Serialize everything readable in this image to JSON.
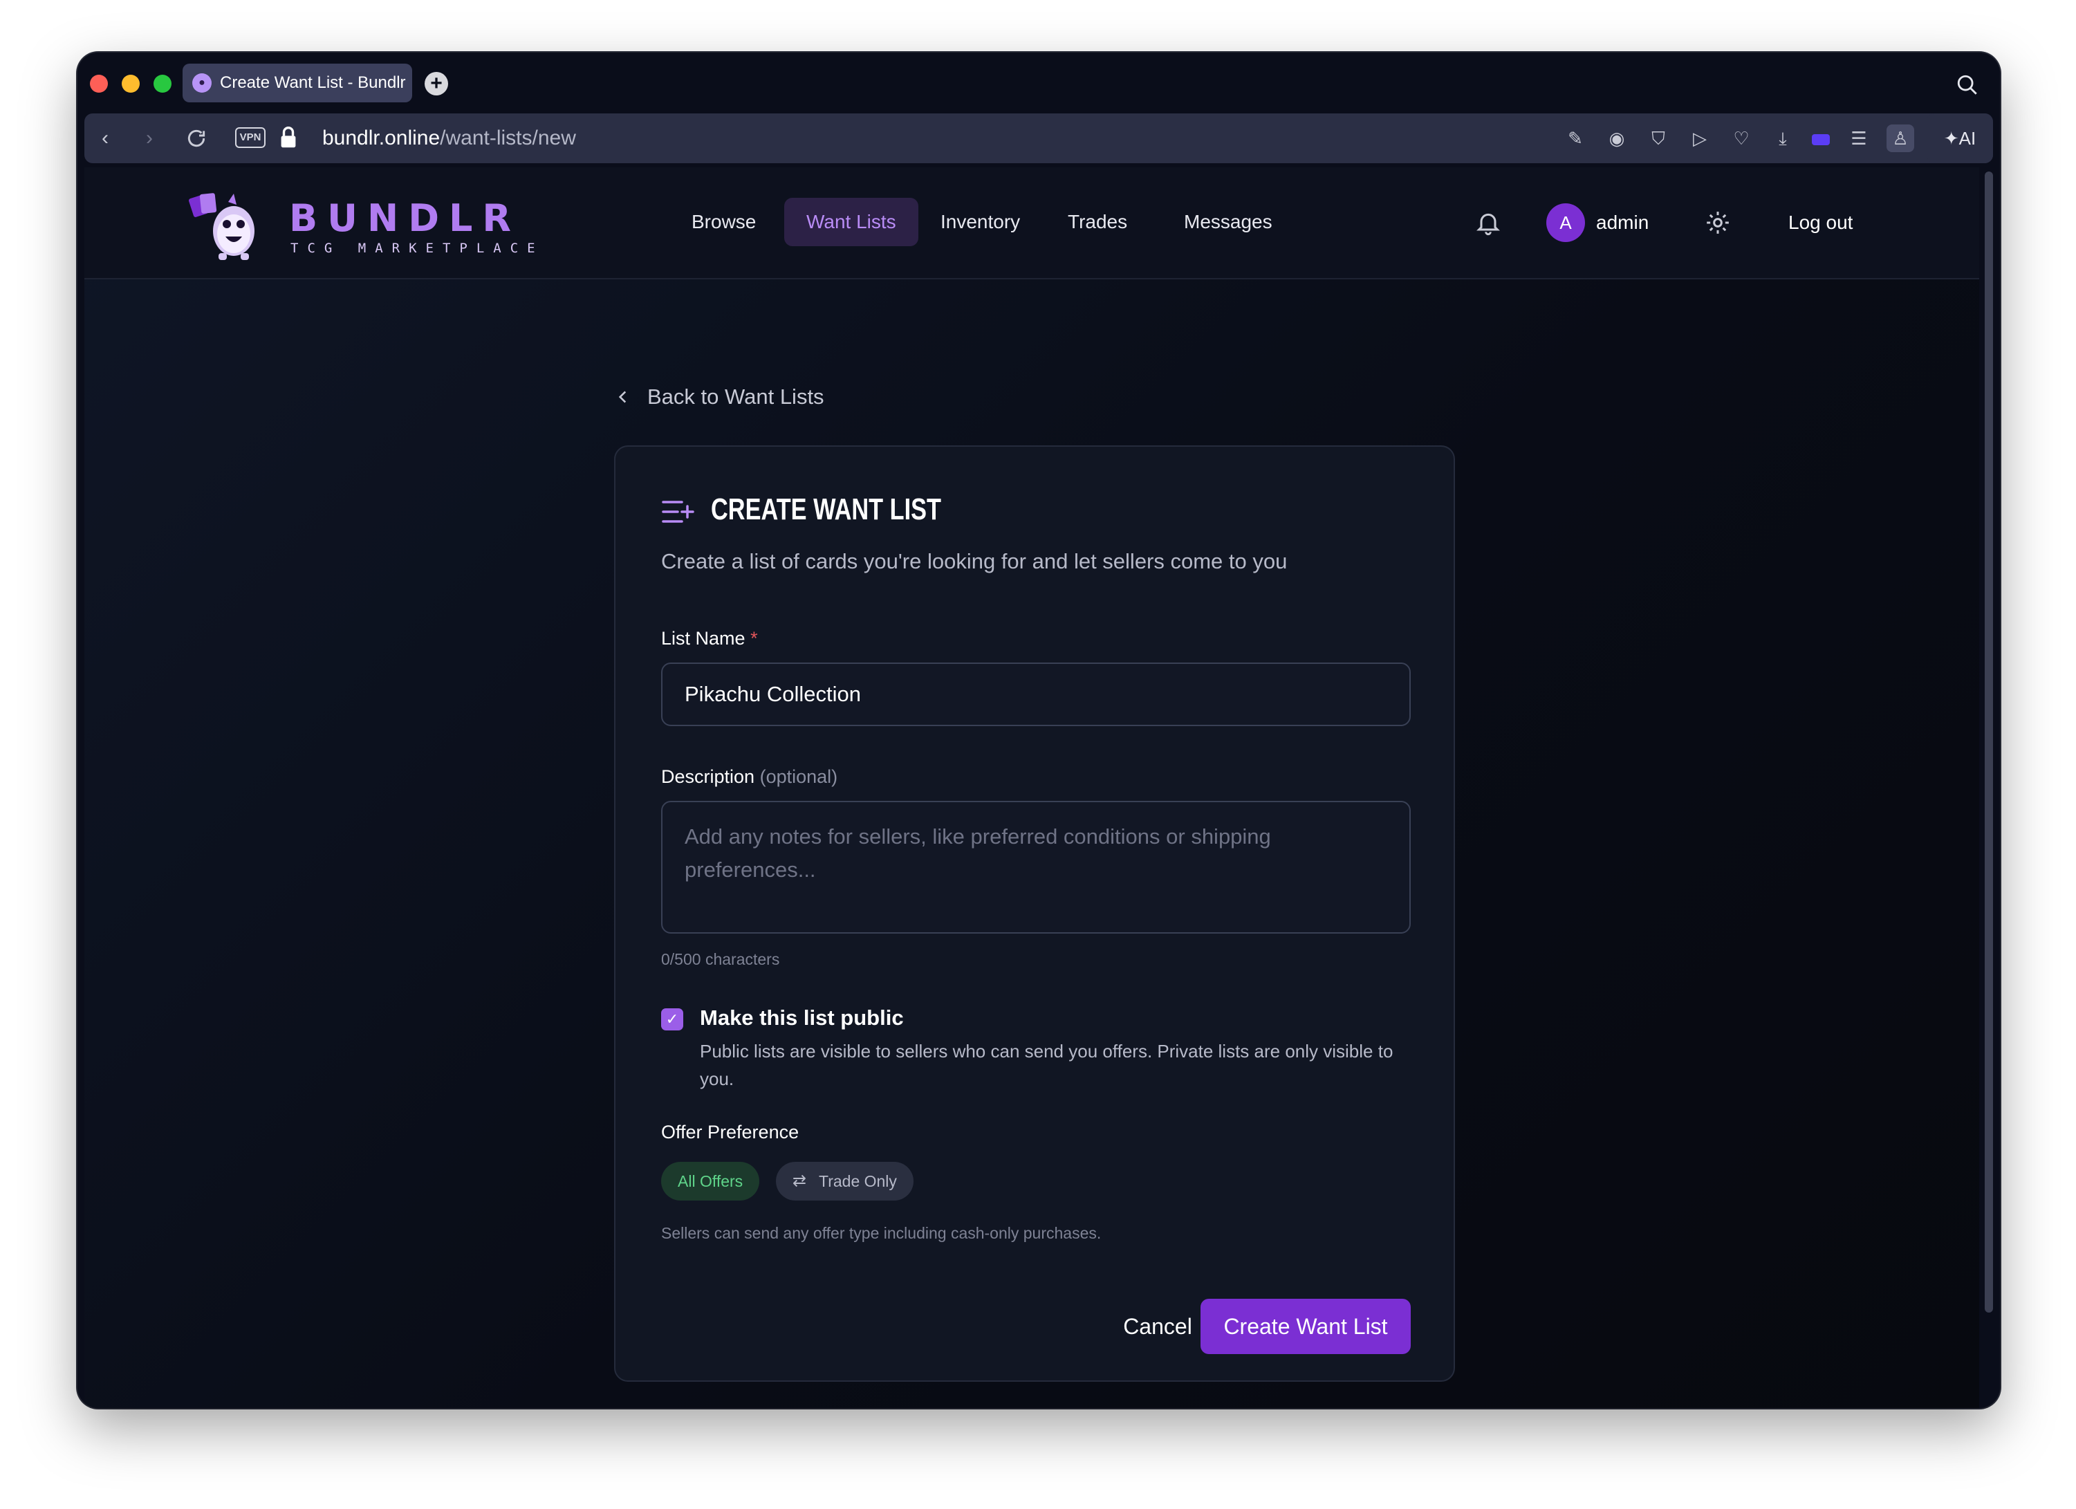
{
  "browser": {
    "tab_title": "Create Want List - Bundlr",
    "url_domain": "bundlr.online",
    "url_path": "/want-lists/new",
    "vpn_label": "VPN",
    "ai_label": "AI"
  },
  "header": {
    "logo_text": "BUNDLR",
    "logo_subtext": "TCG MARKETPLACE",
    "nav": [
      {
        "label": "Browse"
      },
      {
        "label": "Want Lists",
        "active": true
      },
      {
        "label": "Inventory"
      },
      {
        "label": "Trades"
      },
      {
        "label": "Messages"
      }
    ],
    "avatar_initial": "A",
    "username": "admin",
    "logout_label": "Log out",
    "icons": [
      "bell-icon",
      "gear-icon"
    ]
  },
  "back_link": "Back to Want Lists",
  "form": {
    "title": "CREATE WANT LIST",
    "subtitle": "Create a list of cards you're looking for and let sellers come to you",
    "list_name_label": "List Name",
    "required_mark": "*",
    "list_name_value": "Pikachu Collection",
    "description_label": "Description",
    "optional_tag": "(optional)",
    "description_placeholder": "Add any notes for sellers, like preferred conditions or shipping preferences...",
    "char_count": "0/500 characters",
    "public_label": "Make this list public",
    "public_checked": true,
    "public_desc": "Public lists are visible to sellers who can send you offers. Private lists are only visible to you.",
    "offer_pref_label": "Offer Preference",
    "offer_options": [
      "All Offers",
      "Trade Only"
    ],
    "offer_selected": "All Offers",
    "offer_help": "Sellers can send any offer type including cash-only purchases.",
    "cancel_label": "Cancel",
    "submit_label": "Create Want List"
  },
  "colors": {
    "accent": "#7b2fd3",
    "accent_light": "#b98cf6",
    "success": "#5fd48a",
    "background": "#0a0d1a"
  }
}
